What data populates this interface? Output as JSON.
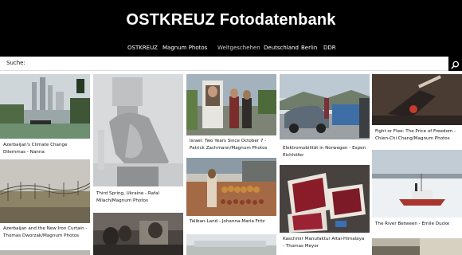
{
  "site": {
    "title": "OSTKREUZ Fotodatenbank"
  },
  "nav": {
    "items": [
      {
        "label": "OSTKREUZ"
      },
      {
        "label": "Magnum Photos"
      },
      {
        "label": "Weltgeschehen"
      },
      {
        "label": "Deutschland"
      },
      {
        "label": "Berlin"
      },
      {
        "label": "DDR"
      }
    ]
  },
  "search": {
    "label": "Suche:",
    "value": "",
    "icon": "search-icon"
  },
  "cards": [
    {
      "caption": "Azerbaijan's Climate Change Dilemmas - Nanna Heitmann/Magnum Photos"
    },
    {
      "caption": "Azerbaijan and the New Iron Curtain - Thomas Dworzak/Magnum Photos"
    },
    {
      "caption": "Third Spring, Ukraine - Rafal Milach/Magnum Photos"
    },
    {
      "caption": "Israel: Two Years Since October 7 - Patrick Zachmann/Magnum Photos"
    },
    {
      "caption": "Taliban-Land - Johanna-Maria Fritz"
    },
    {
      "caption": "Elektromobilität in Norwegen - Espen Eichhöfer"
    },
    {
      "caption": "Kaschmir Manufaktur Altai-Himalaya - Thomas Meyer"
    },
    {
      "caption": "Fight or Flee: The Price of Freedom - Chien-Chi Chang/Magnum Photos"
    },
    {
      "caption": "The River Between - Emile Ducke"
    }
  ],
  "colors": {
    "header_bg": "#000000",
    "page_bg": "#ffffff",
    "text": "#111111"
  }
}
